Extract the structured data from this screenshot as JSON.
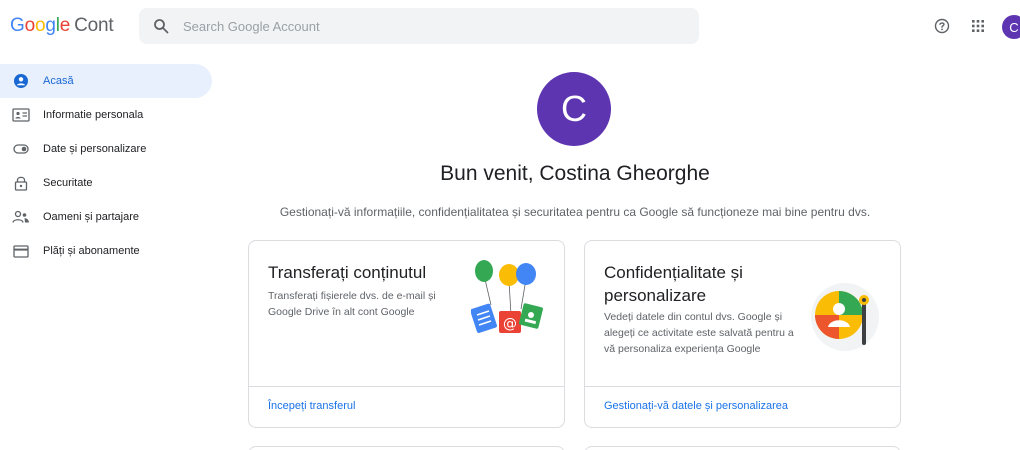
{
  "header": {
    "logo_google": [
      "G",
      "o",
      "o",
      "g",
      "l",
      "e"
    ],
    "logo_product": "Cont",
    "search_placeholder": "Search Google Account",
    "avatar_initial": "C",
    "icons": [
      "search-icon",
      "help-icon",
      "apps-grid-icon"
    ]
  },
  "sidebar": {
    "items": [
      {
        "label": "Acasă",
        "icon": "home-icon",
        "active": true
      },
      {
        "label": "Informatie personala",
        "icon": "id-card-icon",
        "active": false
      },
      {
        "label": "Date și personalizare",
        "icon": "toggle-icon",
        "active": false
      },
      {
        "label": "Securitate",
        "icon": "lock-icon",
        "active": false
      },
      {
        "label": "Oameni și partajare",
        "icon": "people-icon",
        "active": false
      },
      {
        "label": "Plăți și abonamente",
        "icon": "card-icon",
        "active": false
      }
    ]
  },
  "main": {
    "avatar_initial": "C",
    "welcome": "Bun venit, Costina Gheorghe",
    "subtitle": "Gestionați-vă informațiile, confidențialitatea și securitatea pentru ca Google să funcționeze mai bine pentru dvs.",
    "cards": [
      {
        "title": "Transferați conținutul",
        "description": "Transferați fișierele dvs. de e-mail și Google Drive în alt cont Google",
        "link": "Începeți transferul",
        "illustration": "transfer-balloons-illustration"
      },
      {
        "title": "Confidențialitate și personalizare",
        "description": "Vedeți datele din contul dvs. Google și alegeți ce activitate este salvată pentru a vă personaliza experiența Google",
        "link": "Gestionați-vă datele și personalizarea",
        "illustration": "privacy-illustration"
      }
    ]
  },
  "colors": {
    "accent_blue": "#1a73e8",
    "active_bg": "#e8f0fe",
    "avatar_purple": "#5e35b1"
  }
}
